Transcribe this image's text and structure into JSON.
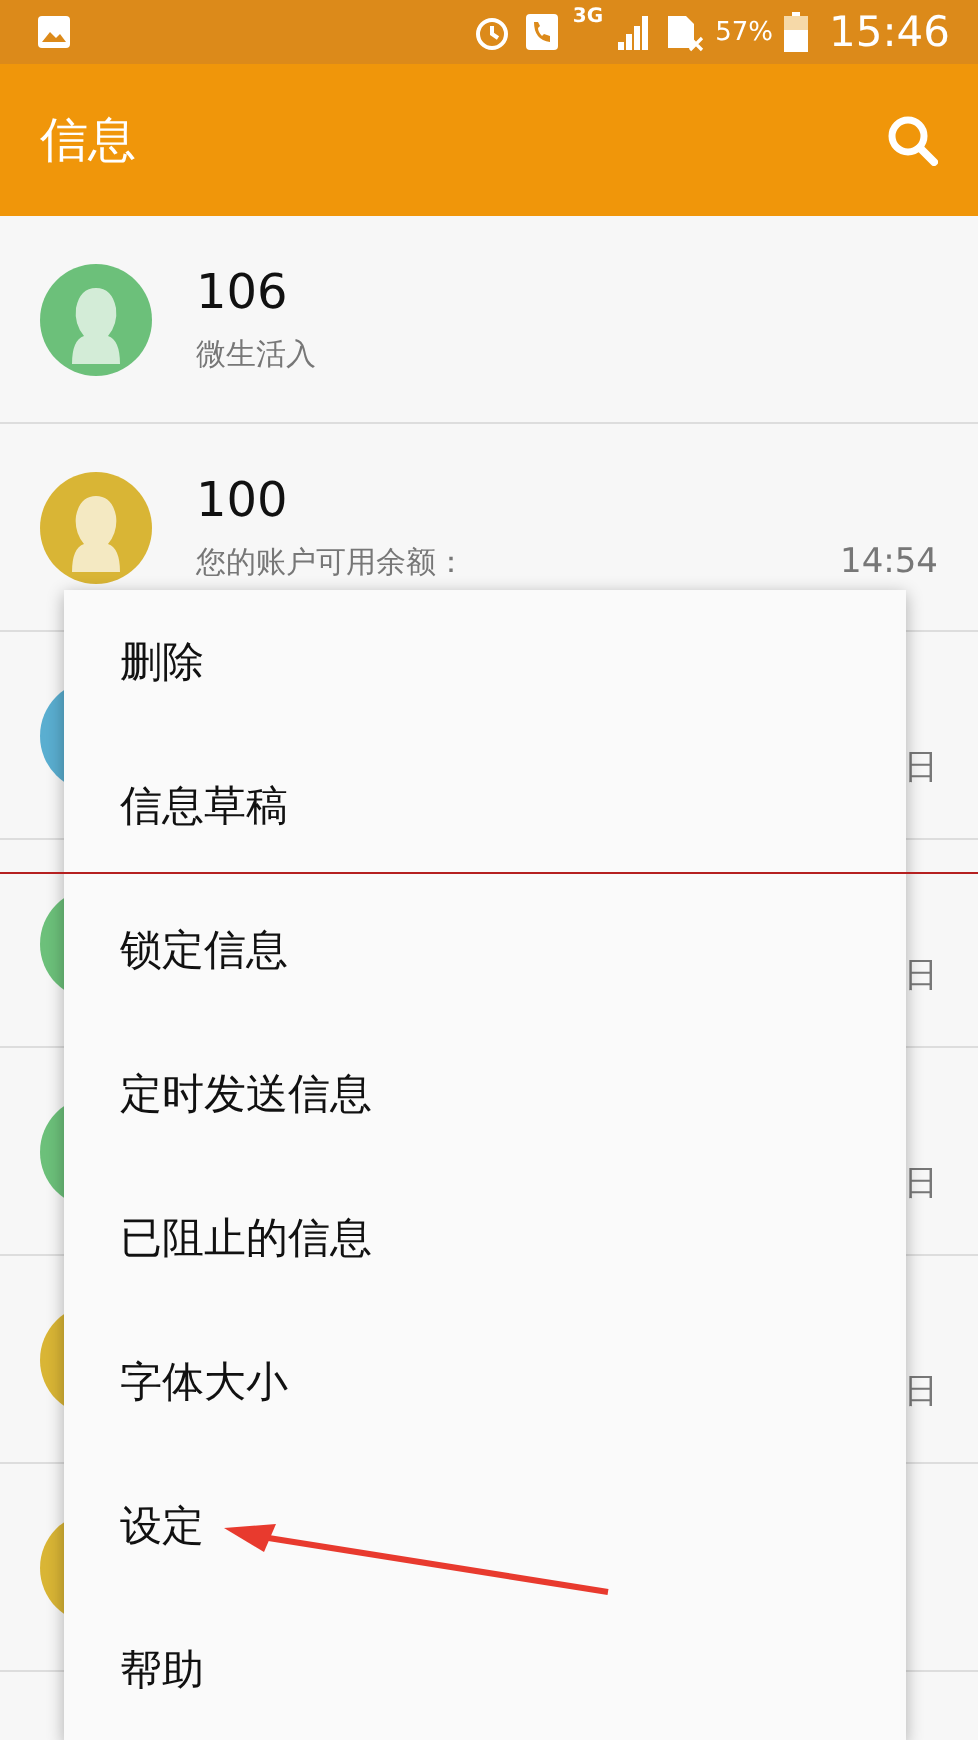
{
  "status_bar": {
    "battery_percent": "57%",
    "network": "3G",
    "time": "15:46"
  },
  "app_bar": {
    "title": "信息"
  },
  "conversations": [
    {
      "name": "106",
      "preview": "微生活入",
      "color": "#6cc07a"
    },
    {
      "name": "100",
      "preview": "您的账户可用余额：",
      "time": "14:54",
      "color": "#d9b535"
    },
    {
      "time": "日",
      "color": "#5aaed0"
    },
    {
      "time": "日",
      "color": "#6cc07a"
    },
    {
      "time": "日",
      "color": "#6cc07a"
    },
    {
      "time": "日",
      "color": "#d9b535"
    },
    {
      "color": "#d9b535"
    }
  ],
  "menu": {
    "items": [
      "删除",
      "信息草稿",
      "锁定信息",
      "定时发送信息",
      "已阻止的信息",
      "字体大小",
      "设定",
      "帮助"
    ]
  }
}
